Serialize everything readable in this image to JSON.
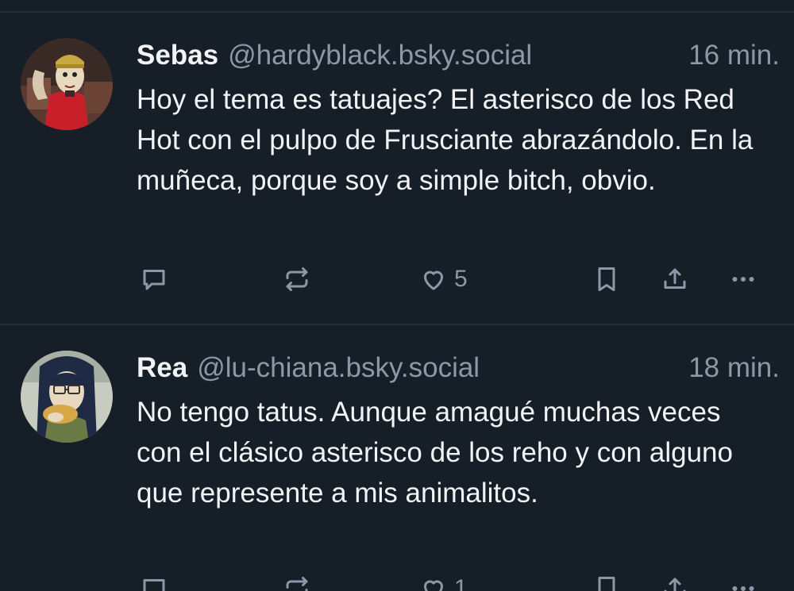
{
  "posts": [
    {
      "display_name": "Sebas",
      "handle": "@hardyblack.bsky.social",
      "time": "16 min.",
      "text": "Hoy el tema es tatuajes? El asterisco de los Red Hot con el pulpo de Frusciante abrazándolo. En la muñeca, porque soy a simple bitch, obvio.",
      "like_count": "5",
      "icons": [
        "reply-icon",
        "repost-icon",
        "heart-icon",
        "bookmark-icon",
        "share-icon",
        "more-icon"
      ]
    },
    {
      "display_name": "Rea",
      "handle": "@lu-chiana.bsky.social",
      "time": "18 min.",
      "text": "No tengo tatus. Aunque amagué muchas veces con el clásico asterisco de los reho y con alguno que represente a mis animalitos.",
      "like_count": "1",
      "icons": [
        "reply-icon",
        "repost-icon",
        "heart-icon",
        "bookmark-icon",
        "share-icon",
        "more-icon"
      ]
    }
  ],
  "colors": {
    "background": "#161e27",
    "divider": "#232e3a",
    "text_primary": "#f1f3f5",
    "text_secondary": "#8b98a8"
  }
}
